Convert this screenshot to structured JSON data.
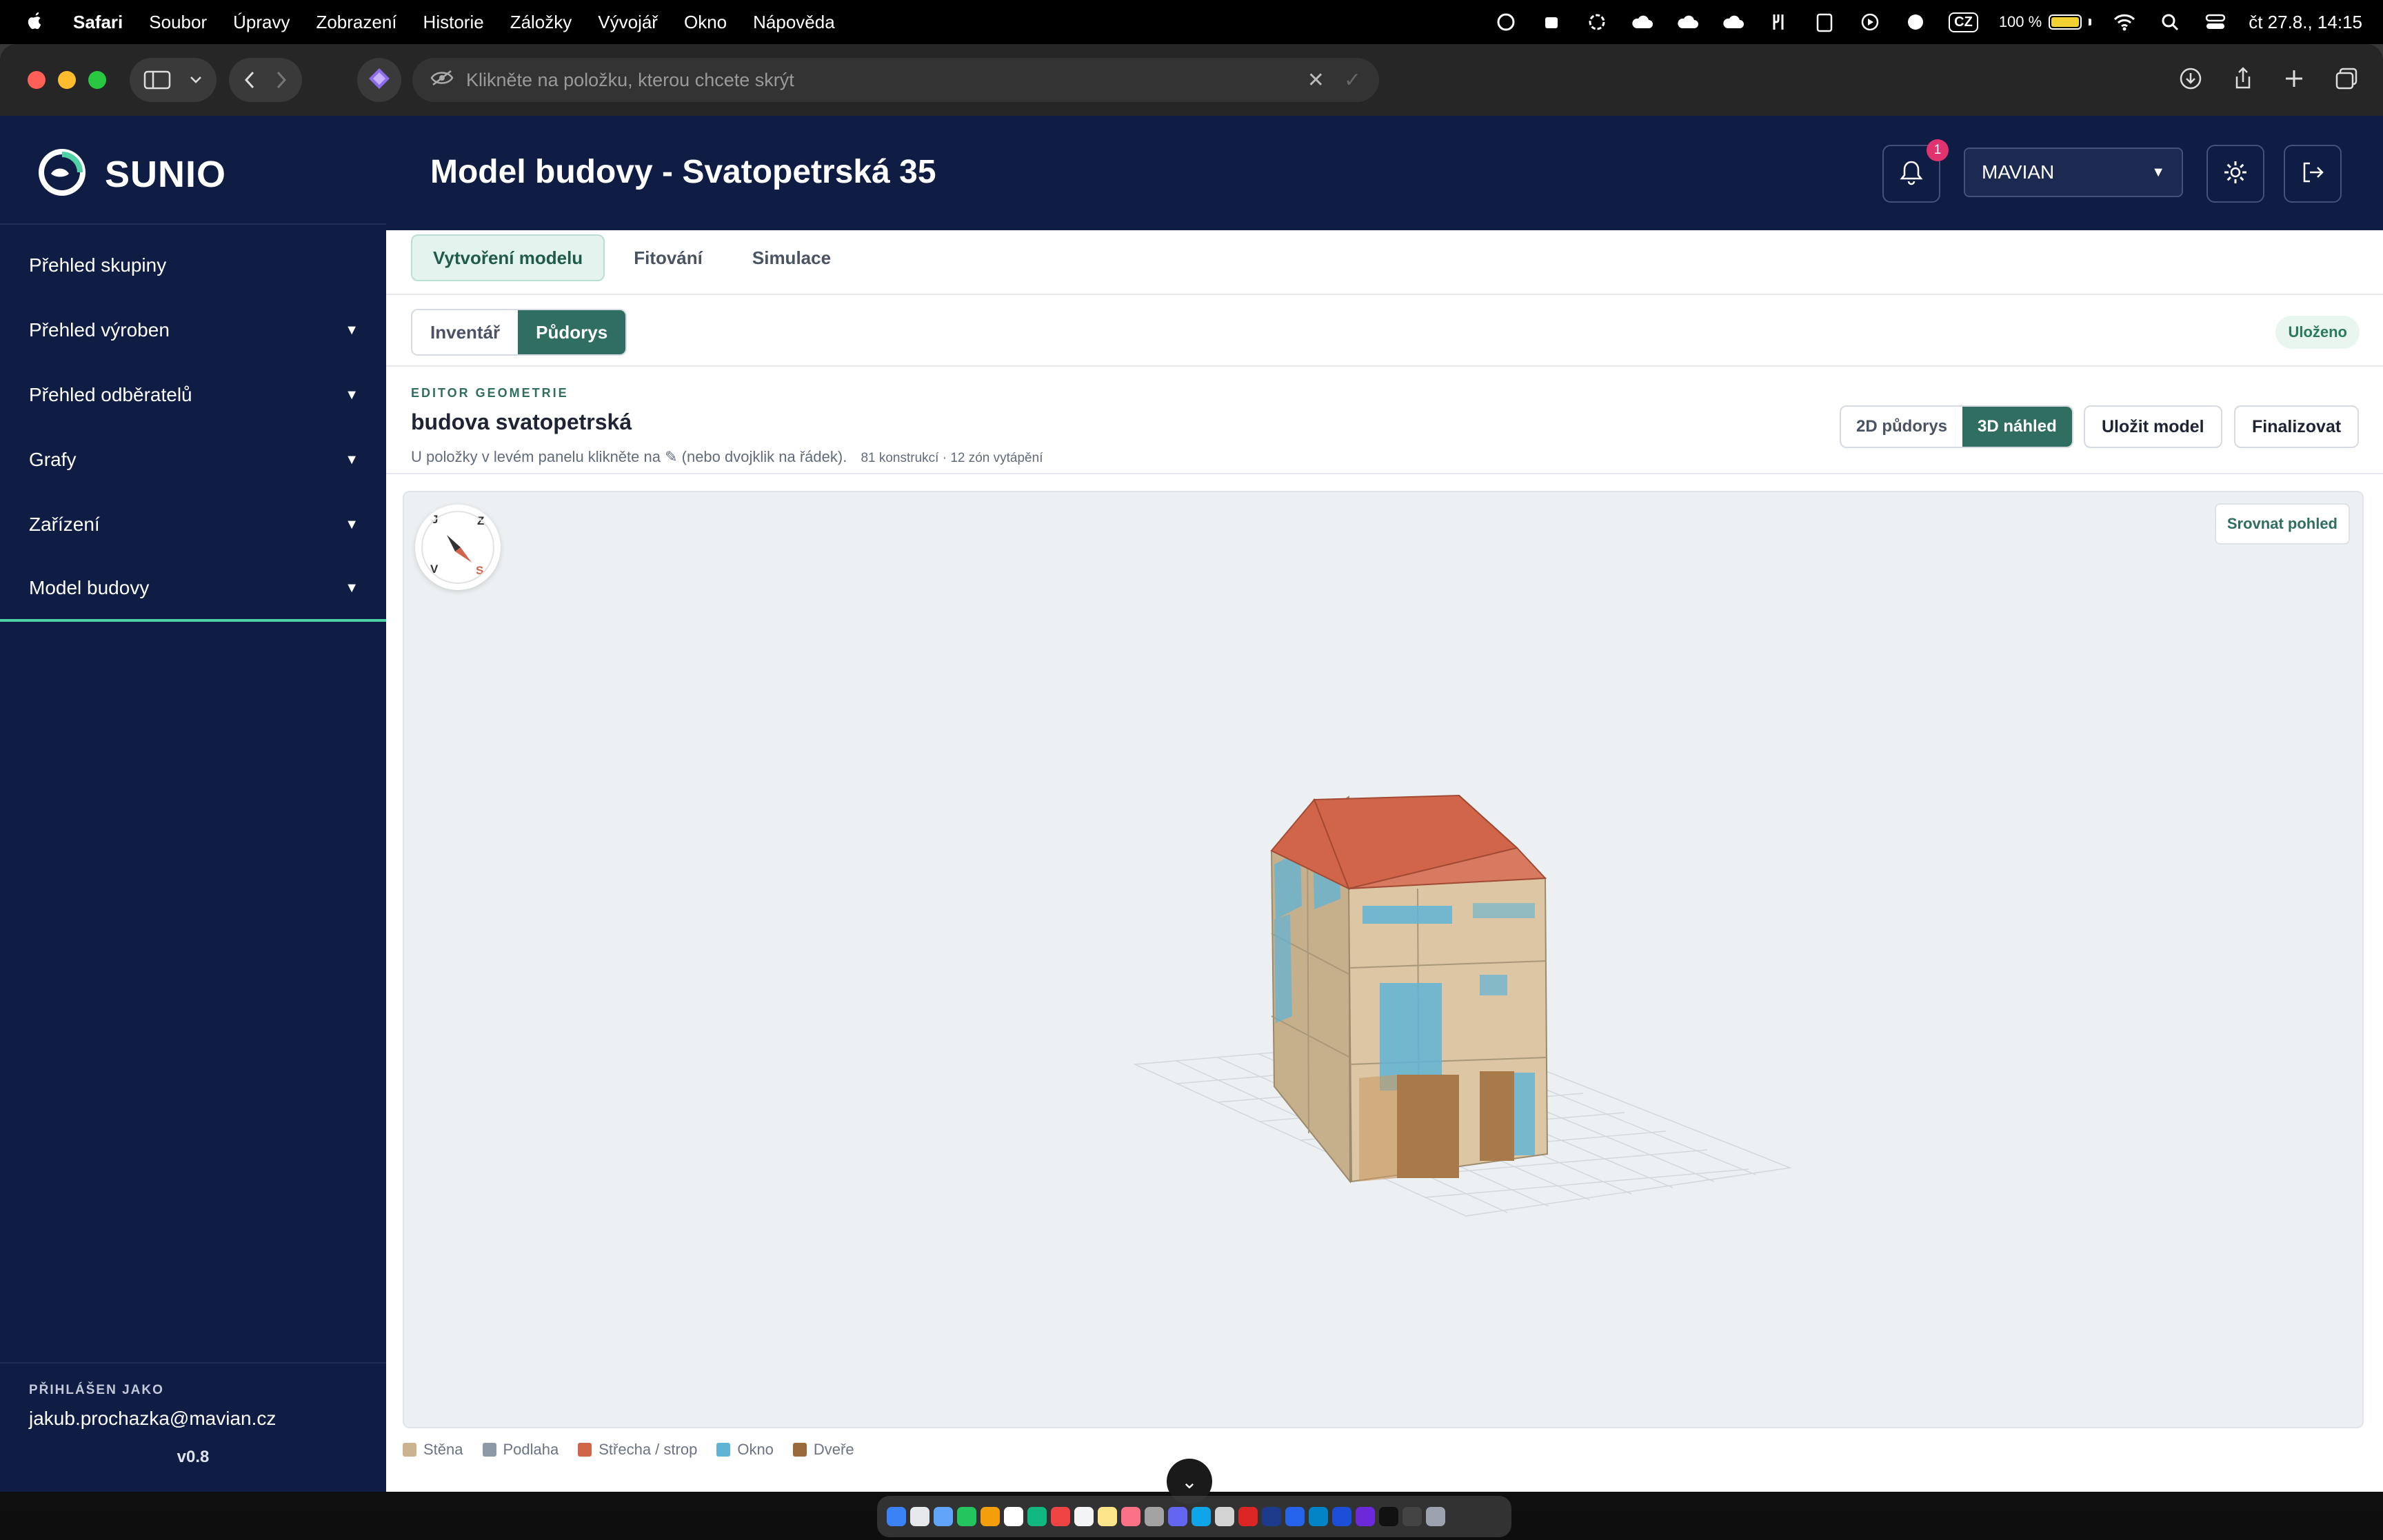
{
  "menubar": {
    "app_name": "Safari",
    "items": [
      "Soubor",
      "Úpravy",
      "Zobrazení",
      "Historie",
      "Záložky",
      "Vývojář",
      "Okno",
      "Nápověda"
    ],
    "input_source": "CZ",
    "battery": "100 %",
    "battery_level": 1.0,
    "datetime": "čt 27.8., 14:15"
  },
  "browser": {
    "url_placeholder": "Klikněte na položku, kterou chcete skrýt"
  },
  "sidebar": {
    "brand": "SUNIO",
    "items": [
      {
        "label": "Přehled skupiny",
        "has_caret": false
      },
      {
        "label": "Přehled výroben",
        "has_caret": true
      },
      {
        "label": "Přehled odběratelů",
        "has_caret": true
      },
      {
        "label": "Grafy",
        "has_caret": true
      },
      {
        "label": "Zařízení",
        "has_caret": true
      },
      {
        "label": "Model budovy",
        "has_caret": true,
        "active": true
      }
    ],
    "caret_symbol": "▼",
    "footer": {
      "logged_as_label": "PŘIHLÁŠEN JAKO",
      "email": "jakub.prochazka@mavian.cz",
      "version": "v0.8"
    }
  },
  "header": {
    "title": "Model budovy - Svatopetrská 35",
    "notifications_count": "1",
    "org_select": "MAVIAN",
    "select_caret": "▼"
  },
  "tabs": {
    "items": [
      "Vytvoření modelu",
      "Fitování",
      "Simulace"
    ],
    "active": "Vytvoření modelu"
  },
  "subtabs": {
    "items": [
      "Inventář",
      "Půdorys"
    ],
    "active": "Půdorys"
  },
  "status": {
    "saved": "Uloženo"
  },
  "editor": {
    "eyebrow": "EDITOR GEOMETRIE",
    "model_name": "budova svatopetrská",
    "hint": "U položky v levém panelu klikněte na ✎ (nebo dvojklik na řádek).",
    "stats": "81 konstrukcí · 12 zón vytápění",
    "view_2d": "2D půdorys",
    "view_3d": "3D náhled",
    "save_button": "Uložit model",
    "finalize_button": "Finalizovat"
  },
  "viewer": {
    "reset_view": "Srovnat pohled",
    "compass": {
      "n": "J",
      "e": "Z",
      "w": "V",
      "s": "S"
    }
  },
  "legend": [
    {
      "label": "Stěna",
      "color": "#c9b48f"
    },
    {
      "label": "Podlaha",
      "color": "#8e99a8"
    },
    {
      "label": "Střecha / strop",
      "color": "#d0654a"
    },
    {
      "label": "Okno",
      "color": "#5fb4d6"
    },
    {
      "label": "Dveře",
      "color": "#9a6a3a"
    }
  ],
  "colors": {
    "sidebar_bg": "#0f1d44",
    "accent": "#2f6e60",
    "active_underline": "#4fd1a5",
    "badge": "#e0336f"
  }
}
